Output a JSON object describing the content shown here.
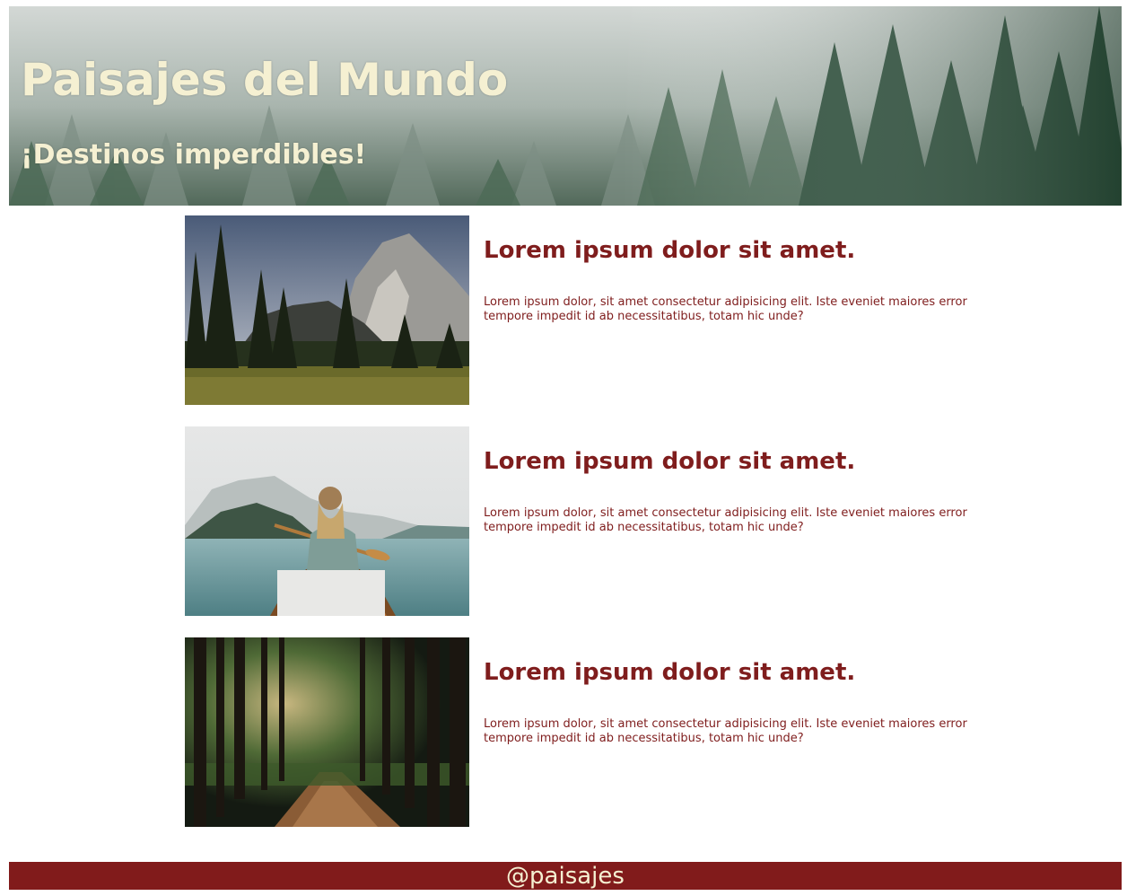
{
  "header": {
    "title": "Paisajes del Mundo",
    "subtitle": "¡Destinos imperdibles!",
    "background_image": "foggy-forest-image"
  },
  "cards": [
    {
      "image": "mountain-valley-image",
      "title": "Lorem ipsum dolor sit amet.",
      "text": "Lorem ipsum dolor, sit amet consectetur adipisicing elit. Iste eveniet maiores error tempore impedit id ab necessitatibus, totam hic unde?"
    },
    {
      "image": "canoe-lake-image",
      "title": "Lorem ipsum dolor sit amet.",
      "text": "Lorem ipsum dolor, sit amet consectetur adipisicing elit. Iste eveniet maiores error tempore impedit id ab necessitatibus, totam hic unde?"
    },
    {
      "image": "forest-path-image",
      "title": "Lorem ipsum dolor sit amet.",
      "text": "Lorem ipsum dolor, sit amet consectetur adipisicing elit. Iste eveniet maiores error tempore impedit id ab necessitatibus, totam hic unde?"
    }
  ],
  "footer": {
    "handle": "@paisajes"
  },
  "colors": {
    "accent": "#7f1d1d",
    "footer_bg": "#811b1b",
    "header_text": "#f5f0d2"
  }
}
